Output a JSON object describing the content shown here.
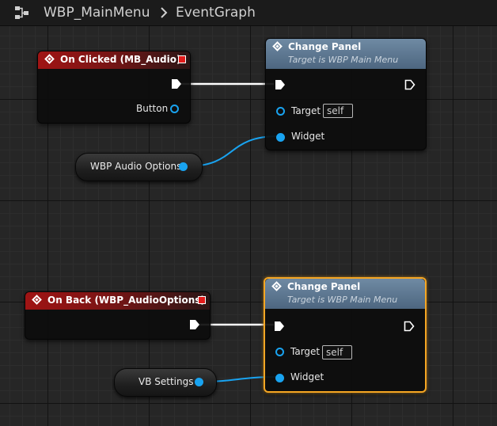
{
  "breadcrumb": {
    "blueprint": "WBP_MainMenu",
    "graph": "EventGraph"
  },
  "nodes": {
    "on_clicked": {
      "title": "On Clicked (MB_Audio)",
      "output_pin": "Button"
    },
    "change_panel_1": {
      "title": "Change Panel",
      "subtitle": "Target is WBP Main Menu",
      "target_label": "Target",
      "target_value": "self",
      "widget_label": "Widget"
    },
    "audio_options_var": {
      "label": "WBP Audio Options"
    },
    "on_back": {
      "title": "On Back (WBP_AudioOptions)"
    },
    "change_panel_2": {
      "title": "Change Panel",
      "subtitle": "Target is WBP Main Menu",
      "target_label": "Target",
      "target_value": "self",
      "widget_label": "Widget"
    },
    "vb_settings_var": {
      "label": "VB Settings"
    }
  },
  "colors": {
    "event_header": "#a01414",
    "function_header": "#5f7a94",
    "object_pin": "#19a3f0",
    "selection": "#f5a623",
    "exec_wire": "#ffffff"
  },
  "icons": {
    "breadcrumb": "blueprint-graph-icon",
    "separator": "chevron-right-icon",
    "node": "diamond-event-icon",
    "delegate": "red-square-delegate-icon",
    "exec": "exec-arrow-icon"
  }
}
